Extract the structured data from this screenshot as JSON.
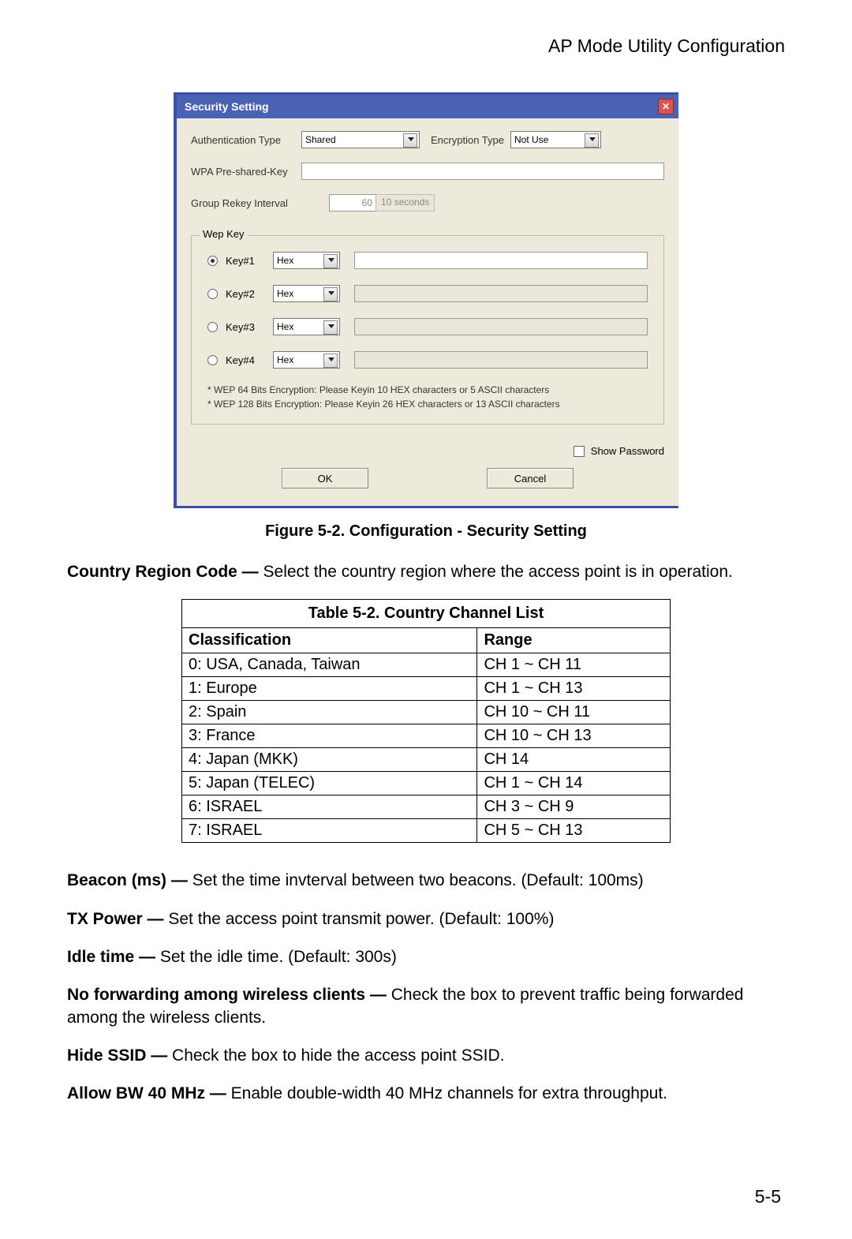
{
  "header": {
    "title": "AP Mode Utility Configuration"
  },
  "dialog": {
    "title": "Security Setting",
    "auth_label": "Authentication Type",
    "auth_value": "Shared",
    "enc_label": "Encryption Type",
    "enc_value": "Not Use",
    "wpa_label": "WPA Pre-shared-Key",
    "rekey_label": "Group Rekey Interval",
    "rekey_value": "60",
    "rekey_unit": "10 seconds",
    "wep_legend": "Wep Key",
    "keys": [
      {
        "label": "Key#1",
        "type": "Hex",
        "checked": true
      },
      {
        "label": "Key#2",
        "type": "Hex",
        "checked": false
      },
      {
        "label": "Key#3",
        "type": "Hex",
        "checked": false
      },
      {
        "label": "Key#4",
        "type": "Hex",
        "checked": false
      }
    ],
    "hint1": "* WEP 64 Bits Encryption:  Please Keyin 10 HEX characters or 5 ASCII characters",
    "hint2": "* WEP 128 Bits Encryption:  Please Keyin 26 HEX characters or 13 ASCII characters",
    "showpw_label": "Show Password",
    "ok": "OK",
    "cancel": "Cancel"
  },
  "figure_caption": "Figure 5-2.  Configuration - Security Setting",
  "body": {
    "country_region": {
      "bold": "Country Region Code —",
      "text": " Select the country region where the access point is in operation."
    },
    "table_title": "Table 5-2. Country Channel List",
    "table_headers": [
      "Classification",
      "Range"
    ],
    "table_rows": [
      [
        "0: USA, Canada, Taiwan",
        "CH 1 ~ CH 11"
      ],
      [
        "1: Europe",
        "CH 1 ~ CH 13"
      ],
      [
        "2: Spain",
        "CH 10 ~ CH 11"
      ],
      [
        "3: France",
        "CH 10 ~ CH 13"
      ],
      [
        "4: Japan (MKK)",
        "CH 14"
      ],
      [
        "5: Japan (TELEC)",
        "CH 1 ~ CH 14"
      ],
      [
        "6: ISRAEL",
        "CH 3 ~ CH 9"
      ],
      [
        "7: ISRAEL",
        "CH 5 ~ CH 13"
      ]
    ],
    "beacon": {
      "bold": "Beacon (ms) —",
      "text": " Set the time invterval between two beacons. (Default: 100ms)"
    },
    "txpower": {
      "bold": "TX Power —",
      "text": " Set the access point transmit power. (Default: 100%)"
    },
    "idle": {
      "bold": "Idle time —",
      "text": " Set the idle time. (Default: 300s)"
    },
    "nofwd": {
      "bold": "No forwarding among wireless clients —",
      "text": " Check the box to prevent traffic being forwarded among the wireless clients."
    },
    "hidessid": {
      "bold": "Hide SSID —",
      "text": " Check the box to hide the access point SSID."
    },
    "bw40": {
      "bold": "Allow BW 40 MHz —",
      "text": " Enable double-width 40 MHz channels for extra throughput."
    }
  },
  "page_number": "5-5"
}
